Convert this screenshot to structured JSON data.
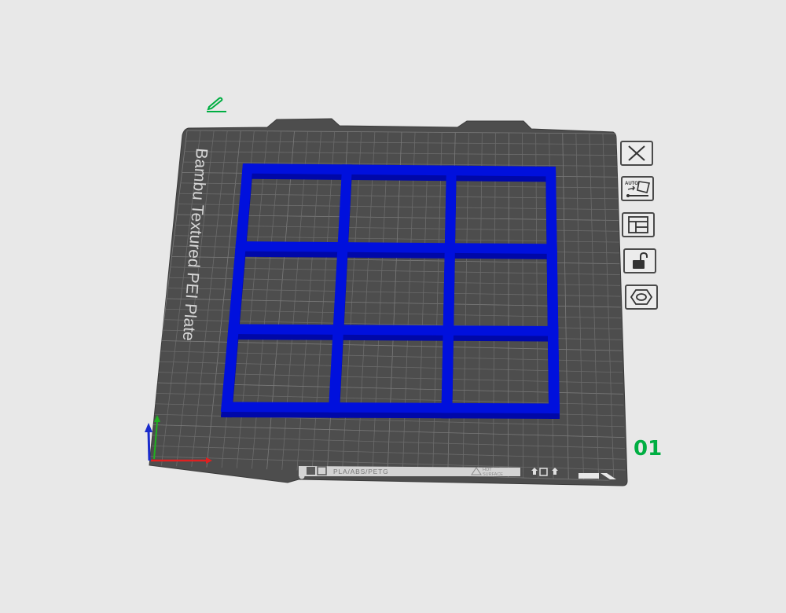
{
  "plate": {
    "name": "Bambu Textured PEI Plate",
    "number": "01",
    "label_strip": {
      "filament_types": "PLA/ABS/PETG",
      "surface_line1": "HOT",
      "surface_line2": "SURFACE"
    }
  },
  "model": {
    "type": "grid frame",
    "rows": 3,
    "columns": 3,
    "color": "#0010dd"
  },
  "toolbar": {
    "items": [
      {
        "name": "remove-plate-button",
        "icon": "close-icon"
      },
      {
        "name": "auto-arrange-button",
        "icon": "auto-arrange-icon"
      },
      {
        "name": "plate-settings-button",
        "icon": "layout-icon"
      },
      {
        "name": "lock-plate-button",
        "icon": "unlock-icon"
      },
      {
        "name": "plate-type-button",
        "icon": "hexagon-nut-icon"
      }
    ]
  },
  "colors": {
    "background": "#e8e8e8",
    "plate": "#4d4d4d",
    "grid": "#6a6a6a",
    "accent": "#00ae42",
    "axis_x": "#e02020",
    "axis_y": "#20b020",
    "axis_z": "#1a2bcc"
  }
}
